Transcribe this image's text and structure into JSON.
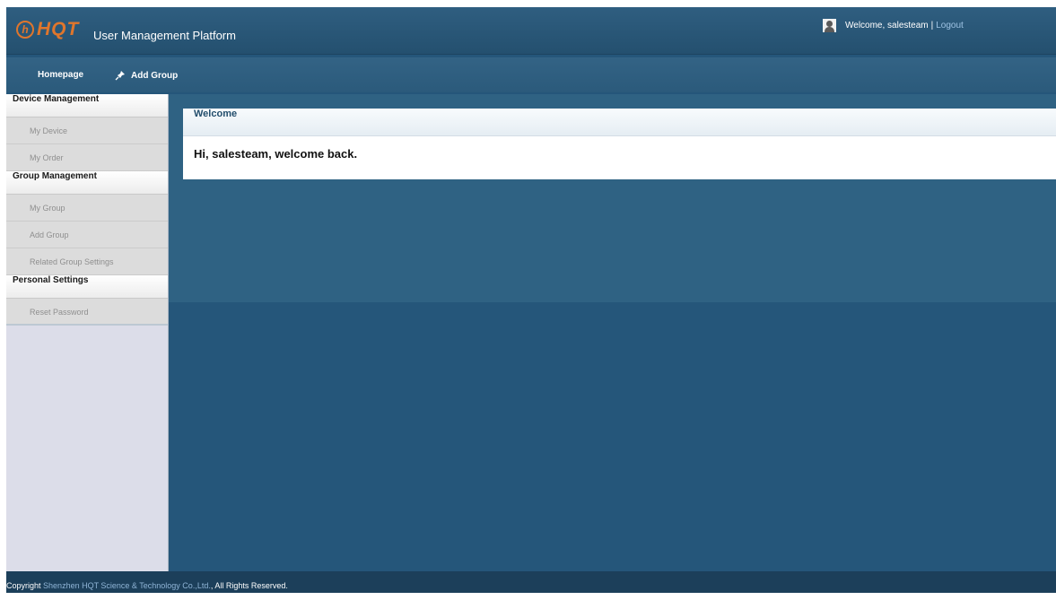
{
  "header": {
    "logo_text": "HQT",
    "app_title": "User Management Platform",
    "welcome_text": "Welcome, salesteam",
    "separator": "|",
    "logout_label": "Logout"
  },
  "navbar": {
    "items": [
      {
        "label": "Homepage"
      },
      {
        "label": "Add Group",
        "icon": "pin-icon"
      }
    ]
  },
  "sidebar": {
    "sections": [
      {
        "title": "Device Management",
        "items": [
          {
            "label": "My Device"
          },
          {
            "label": "My Order"
          }
        ]
      },
      {
        "title": "Group Management",
        "items": [
          {
            "label": "My Group"
          },
          {
            "label": "Add Group"
          },
          {
            "label": "Related Group Settings"
          }
        ]
      },
      {
        "title": "Personal Settings",
        "items": [
          {
            "label": "Reset Password"
          }
        ]
      }
    ]
  },
  "main": {
    "panel_title": "Welcome",
    "panel_message": "Hi, salesteam, welcome back."
  },
  "footer": {
    "prefix": "Copyright",
    "company": "Shenzhen HQT Science & Technology Co.,Ltd.",
    "suffix": "All Rights Reserved."
  },
  "colors": {
    "brand_orange": "#e0762c",
    "header_blue": "#2f5e80",
    "content_blue": "#25567a",
    "sidebar_bg": "#dcdde9"
  }
}
